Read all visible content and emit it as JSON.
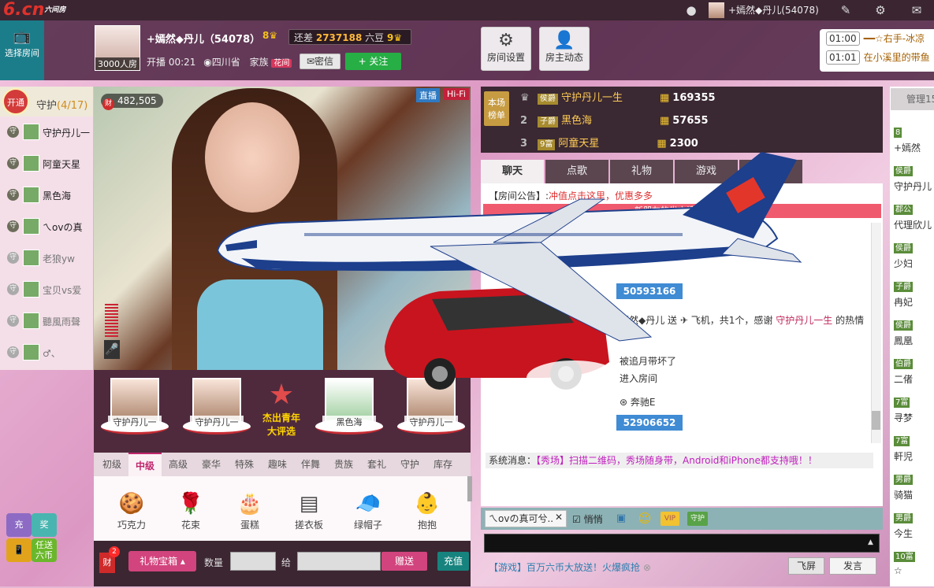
{
  "topbar": {
    "logo": "6.cn",
    "logo_sub": "六间房",
    "user_name": "+嫣然◆丹儿(54078)"
  },
  "left_tab": {
    "label": "选择房间"
  },
  "anchor": {
    "name": "+嫣然◆丹儿（54078）",
    "level": "8",
    "room_count": "3000人房",
    "gap_label": "还差",
    "gap_value": "2737188",
    "gap_unit": "六豆",
    "gap_level": "9",
    "live_time": "开播 00:21",
    "location": "四川省",
    "family_label": "家族",
    "family_tag": "花间",
    "msg_btn": "密信",
    "follow_btn": "+ 关注"
  },
  "header_buttons": [
    {
      "label": "房间设置",
      "icon": "gear-icon"
    },
    {
      "label": "房主动态",
      "icon": "person-icon"
    }
  ],
  "notices": [
    {
      "time": "01:00",
      "text": "━━☆右手-冰凉"
    },
    {
      "time": "01:01",
      "text": "在小溪里的带鱼"
    }
  ],
  "guard": {
    "badge": "开通",
    "title": "守护",
    "count": "(4/17)",
    "members": [
      {
        "name": "守护丹儿一",
        "dim": false
      },
      {
        "name": "阿童天星",
        "dim": false
      },
      {
        "name": "黑色海",
        "dim": false
      },
      {
        "name": "ㄟovの真",
        "dim": false
      },
      {
        "name": "老狼yw",
        "dim": true
      },
      {
        "name": "宝贝vs爱",
        "dim": true
      },
      {
        "name": "聽風雨聲",
        "dim": true
      },
      {
        "name": "♂、",
        "dim": true
      }
    ]
  },
  "video": {
    "wealth": "482,505",
    "live": "直播",
    "hifi": "Hi-Fi"
  },
  "guardian_cards": [
    {
      "label": "守护丹儿一"
    },
    {
      "label": "守护丹儿一"
    },
    {
      "label": "黑色海"
    },
    {
      "label": "守护丹儿一"
    }
  ],
  "award": {
    "line1": "杰出青年",
    "line2": "大评选"
  },
  "gift_tabs": [
    "初级",
    "中级",
    "高级",
    "豪华",
    "特殊",
    "趣味",
    "伴舞",
    "贵族",
    "套礼",
    "守护",
    "库存"
  ],
  "active_gift_tab": "中级",
  "gifts": [
    {
      "name": "巧克力",
      "icon": "chocolate-icon",
      "glyph": "🍪"
    },
    {
      "name": "花束",
      "icon": "rose-icon",
      "glyph": "🌹"
    },
    {
      "name": "蛋糕",
      "icon": "cake-icon",
      "glyph": "🎂"
    },
    {
      "name": "搓衣板",
      "icon": "washboard-icon",
      "glyph": "▤"
    },
    {
      "name": "绿帽子",
      "icon": "green-hat-icon",
      "glyph": "🧢"
    },
    {
      "name": "抱抱",
      "icon": "hug-icon",
      "glyph": "👶"
    }
  ],
  "send_bar": {
    "cai_badge": "2",
    "cai": "财",
    "box": "礼物宝箱",
    "qty": "数量",
    "to": "给",
    "give": "赠送",
    "recharge": "充值"
  },
  "left_tools": {
    "charge": "充",
    "award": "奖",
    "mobile_line1": "任送",
    "mobile_line2": "六币"
  },
  "rank": {
    "label_line1": "本场",
    "label_line2": "榜单",
    "rows": [
      {
        "n": "",
        "tag": "侯爵",
        "name": "守护丹儿一生",
        "value": "169355"
      },
      {
        "n": "2",
        "tag": "子爵",
        "name": "黑色海",
        "value": "57655"
      },
      {
        "n": "3",
        "tag": "9富",
        "name": "阿童天星",
        "value": "2300"
      }
    ]
  },
  "chat_tabs": [
    "聊天",
    "点歌",
    "礼物",
    "游戏",
    ""
  ],
  "chat": {
    "announce_label": "【房间公告】:",
    "announce_link": "冲值点击这里，优惠多多",
    "new_warn": "新朋友的发言请不要超过",
    "gift_num1": "50593166",
    "gift_line": "嫣然◆丹儿 送",
    "gift_line2": "飞机，共1个，感谢",
    "gift_user": "守护丹儿一生",
    "gift_tail": "的热情",
    "line_a": "被追月带坏了",
    "line_b": "进入房间",
    "line_c": "奔驰E",
    "gift_num2": "52906652",
    "sys_label": "系统消息：",
    "sys_text": "【秀场】扫描二维码，秀场随身带，Android和iPhone都支持哦！！"
  },
  "chat_tool": {
    "target": "ㄟovの真可兮..",
    "whisper": "悄悄",
    "vip": "VIP",
    "guard": "守护"
  },
  "game_line": "【游戏】百万六币大放送！火爆疯抢",
  "fullscreen": "飞屏",
  "speak": "发言",
  "right_panel": {
    "head": "管理15",
    "rows": [
      {
        "tag": "8",
        "name": "+嫣然"
      },
      {
        "tag": "侯爵",
        "name": "守护丹儿"
      },
      {
        "tag": "郡公",
        "name": "代理欣儿"
      },
      {
        "tag": "侯爵",
        "name": "少妇"
      },
      {
        "tag": "子爵",
        "name": "冉妃"
      },
      {
        "tag": "侯爵",
        "name": "鳳凰"
      },
      {
        "tag": "伯爵",
        "name": "二偖"
      },
      {
        "tag": "7富",
        "name": "寻梦"
      },
      {
        "tag": "7富",
        "name": "軒児"
      },
      {
        "tag": "男爵",
        "name": "骑猫"
      },
      {
        "tag": "男爵",
        "name": "今生"
      },
      {
        "tag": "10富",
        "name": "☆"
      }
    ]
  },
  "colors": {
    "accent": "#d2447e",
    "teal": "#17837e",
    "follow": "#27ae45"
  }
}
